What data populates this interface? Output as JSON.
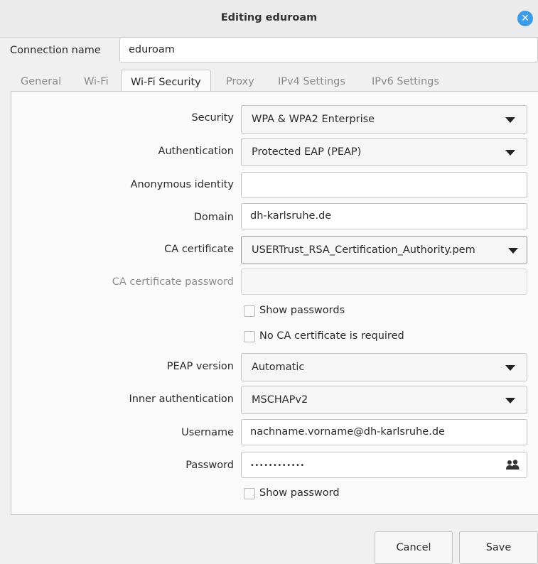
{
  "window": {
    "title": "Editing eduroam"
  },
  "connection": {
    "label": "Connection name",
    "value": "eduroam"
  },
  "tabs": [
    {
      "label": "General"
    },
    {
      "label": "Wi-Fi"
    },
    {
      "label": "Wi-Fi Security"
    },
    {
      "label": "Proxy"
    },
    {
      "label": "IPv4 Settings"
    },
    {
      "label": "IPv6 Settings"
    }
  ],
  "active_tab": "Wi-Fi Security",
  "form": {
    "security": {
      "label": "Security",
      "value": "WPA & WPA2 Enterprise"
    },
    "authentication": {
      "label": "Authentication",
      "value": "Protected EAP (PEAP)"
    },
    "anonymous_identity": {
      "label": "Anonymous identity",
      "value": ""
    },
    "domain": {
      "label": "Domain",
      "value": "dh-karlsruhe.de"
    },
    "ca_certificate": {
      "label": "CA certificate",
      "value": "USERTrust_RSA_Certification_Authority.pem"
    },
    "ca_certificate_password": {
      "label": "CA certificate password",
      "value": ""
    },
    "show_passwords": {
      "label": "Show passwords",
      "checked": false
    },
    "no_ca_required": {
      "label": "No CA certificate is required",
      "checked": false
    },
    "peap_version": {
      "label": "PEAP version",
      "value": "Automatic"
    },
    "inner_authentication": {
      "label": "Inner authentication",
      "value": "MSCHAPv2"
    },
    "username": {
      "label": "Username",
      "value": "nachname.vorname@dh-karlsruhe.de"
    },
    "password": {
      "label": "Password",
      "value": "••••••••••••"
    },
    "show_password": {
      "label": "Show password",
      "checked": false
    }
  },
  "buttons": {
    "cancel": "Cancel",
    "save": "Save"
  },
  "colors": {
    "accent": "#3d9ce8",
    "window_bg": "#f0f0f0",
    "titlebar_bg": "#ebebeb"
  }
}
